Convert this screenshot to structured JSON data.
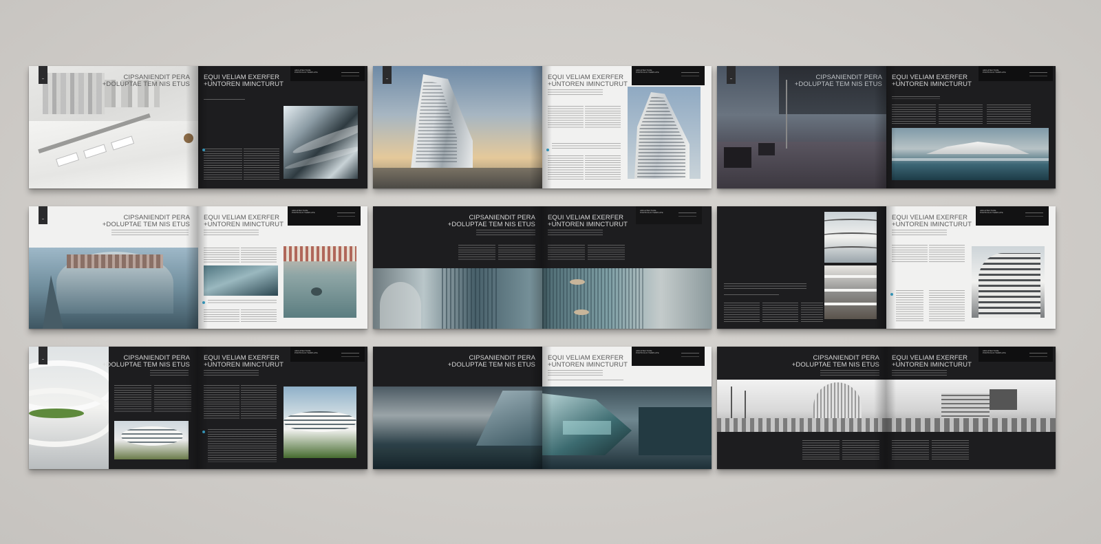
{
  "headings": {
    "left": [
      "CIPSANIENDIT PERA",
      "+DOLUPTAE TEM NIS ETUS"
    ],
    "right": [
      "EQUI VELIAM EXERFER",
      "+UNTOREN IMINCTURUT"
    ]
  },
  "brand_box": [
    "ARCHITECTURE",
    "PORTFOLIO TEMPLATE"
  ],
  "colors": {
    "background": "#d0cdc9",
    "dark_page": "#1d1d1f",
    "light_page": "#f1f1f0",
    "accent": "#3aa3c9"
  },
  "spreads": [
    {
      "id": "spread-1",
      "left": "photo-city-model",
      "right": "dark-text-photo"
    },
    {
      "id": "spread-2",
      "left": "photo-curved-tower",
      "right": "light-text-photo"
    },
    {
      "id": "spread-3",
      "left": "photo-terrace-interior",
      "right": "dark-text-panorama"
    },
    {
      "id": "spread-4",
      "left": "light-heading-photo",
      "right": "light-text-photos"
    },
    {
      "id": "spread-5",
      "left": "dark-heading-wide-photo",
      "right": "dark-heading-wide-photo"
    },
    {
      "id": "spread-6",
      "left": "dark-text-photo-stack",
      "right": "light-text-photo"
    },
    {
      "id": "spread-7",
      "left": "photo-white-curves",
      "right": "dark-text-photos"
    },
    {
      "id": "spread-8",
      "left": "dark-heading-panorama",
      "right": "light-heading-panorama"
    },
    {
      "id": "spread-9",
      "left": "sketch-panorama",
      "right": "sketch-panorama"
    }
  ]
}
